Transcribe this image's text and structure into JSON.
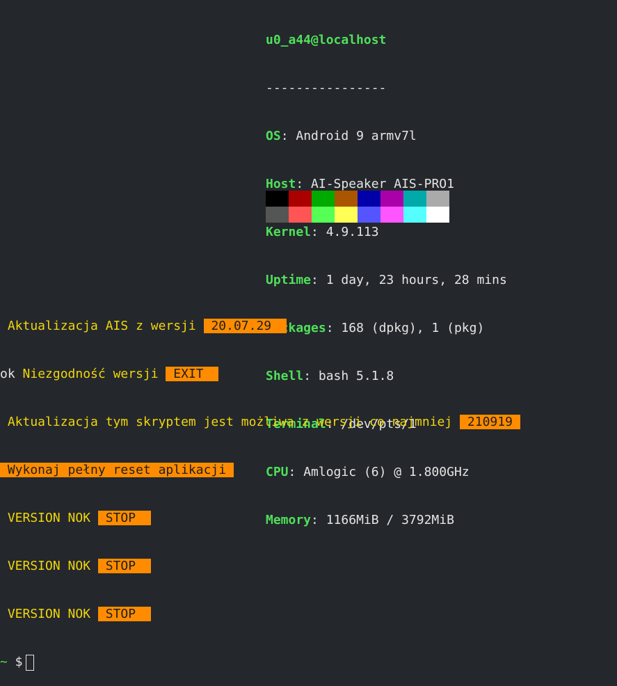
{
  "neofetch": {
    "user_host": "u0_a44@localhost",
    "separator": "----------------",
    "fields": [
      {
        "key": "OS",
        "value": "Android 9 armv7l"
      },
      {
        "key": "Host",
        "value": "AI-Speaker AIS-PRO1"
      },
      {
        "key": "Kernel",
        "value": "4.9.113"
      },
      {
        "key": "Uptime",
        "value": "1 day, 23 hours, 28 mins"
      },
      {
        "key": "Packages",
        "value": "168 (dpkg), 1 (pkg)"
      },
      {
        "key": "Shell",
        "value": "bash 5.1.8"
      },
      {
        "key": "Terminal",
        "value": "/dev/pts/1"
      },
      {
        "key": "CPU",
        "value": "Amlogic (6) @ 1.800GHz"
      },
      {
        "key": "Memory",
        "value": "1166MiB / 3792MiB"
      }
    ],
    "palette": [
      "#000000",
      "#aa0000",
      "#00aa00",
      "#aa5500",
      "#0000aa",
      "#aa00aa",
      "#00aaaa",
      "#aaaaaa",
      "#555555",
      "#ff5555",
      "#55ff55",
      "#ffff55",
      "#5555ff",
      "#ff55ff",
      "#55ffff",
      "#ffffff"
    ],
    "logo_color": "#c9761c"
  },
  "output": {
    "line1_text": " Aktualizacja AIS z wersji ",
    "line1_badge": " 20.07.29  ",
    "line2_prefix": "ok",
    "line2_text": " Niezgodność wersji ",
    "line2_badge": " EXIT  ",
    "line3_text": " Aktualizacja tym skryptem jest możliwa z wersji co najmniej ",
    "line3_badge": " 210919 ",
    "line4_badge": " Wykonaj pełny reset aplikacji ",
    "version_rows": [
      {
        "text": " VERSION NOK ",
        "badge": " STOP  "
      },
      {
        "text": " VERSION NOK ",
        "badge": " STOP  "
      },
      {
        "text": " VERSION NOK ",
        "badge": " STOP  "
      }
    ],
    "prompt_tilde": "~",
    "prompt_symbol": " $"
  }
}
